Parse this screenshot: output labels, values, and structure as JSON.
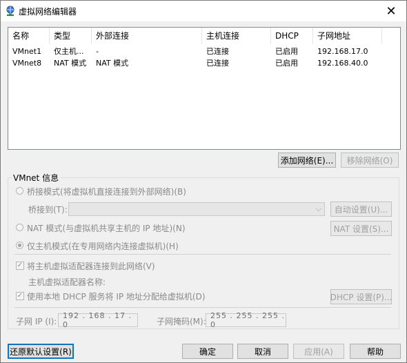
{
  "window": {
    "title": "虚拟网络编辑器",
    "close_glyph": "✕"
  },
  "table": {
    "headers": [
      "名称",
      "类型",
      "外部连接",
      "主机连接",
      "DHCP",
      "子网地址"
    ],
    "rows": [
      [
        "VMnet1",
        "仅主机...",
        "-",
        "已连接",
        "已启用",
        "192.168.17.0"
      ],
      [
        "VMnet8",
        "NAT 模式",
        "NAT 模式",
        "已连接",
        "已启用",
        "192.168.40.0"
      ]
    ]
  },
  "list_buttons": {
    "add": "添加网络(E)...",
    "remove": "移除网络(O)"
  },
  "vmnet_info": {
    "label": "VMnet 信息",
    "bridged_mode": "桥接模式(将虚拟机直接连接到外部网络)(B)",
    "bridged_to_label": "桥接到(T):",
    "bridged_to_value": "",
    "auto_settings": "自动设置(U)...",
    "nat_mode": "NAT 模式(与虚拟机共享主机的 IP 地址)(N)",
    "nat_settings": "NAT 设置(S)...",
    "host_only_mode": "仅主机模式(在专用网络内连接虚拟机)(H)",
    "connect_adapter": "将主机虚拟适配器连接到此网络(V)",
    "adapter_name_label": "主机虚拟适配器名称:",
    "use_dhcp": "使用本地 DHCP 服务将 IP 地址分配给虚拟机(D)",
    "dhcp_settings": "DHCP 设置(P)...",
    "subnet_ip_label": "子网 IP (I):",
    "subnet_ip_value": "192 . 168 . 17 . 0",
    "subnet_mask_label": "子网掩码(M):",
    "subnet_mask_value": "255 . 255 . 255 . 0",
    "selected_mode": "host-only",
    "connect_adapter_checked": true,
    "use_dhcp_checked": true
  },
  "footer": {
    "restore": "还原默认设置(R)",
    "ok": "确定",
    "cancel": "取消",
    "apply": "应用(A)",
    "help": "帮助"
  },
  "colors": {
    "focus": "#0078d7",
    "window_bg": "#f0f0f0",
    "disabled_text": "#8a8a8a"
  }
}
